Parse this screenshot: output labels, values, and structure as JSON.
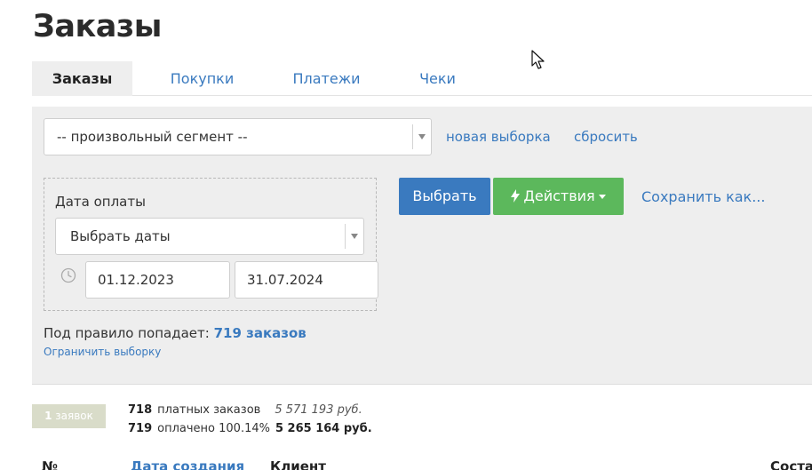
{
  "page": {
    "title": "Заказы"
  },
  "tabs": [
    {
      "label": "Заказы",
      "active": true
    },
    {
      "label": "Покупки",
      "active": false
    },
    {
      "label": "Платежи",
      "active": false
    },
    {
      "label": "Чеки",
      "active": false
    }
  ],
  "filter": {
    "segment_value": "-- произвольный сегмент --",
    "new_selection_link": "новая выборка",
    "reset_link": "сбросить",
    "date": {
      "label": "Дата оплаты",
      "select_value": "Выбрать даты",
      "from": "01.12.2023",
      "to": "31.07.2024"
    },
    "buttons": {
      "select": "Выбрать",
      "actions": "Действия",
      "save_as": "Сохранить как..."
    },
    "rule": {
      "prefix": "Под правило попадает:",
      "count": "719 заказов"
    },
    "limit_link": "Ограничить выборку"
  },
  "summary": {
    "badge_count": "1",
    "badge_label": "заявок",
    "paid_orders": {
      "count": "718",
      "label": "платных заказов",
      "sum": "5 571 193 руб."
    },
    "paid": {
      "count": "719",
      "label": "оплачено 100.14%",
      "sum": "5 265 164 руб."
    }
  },
  "table": {
    "columns": [
      "№",
      "Дата создания",
      "Клиент",
      "Соста"
    ]
  },
  "colors": {
    "link": "#3a7abf",
    "primary": "#3a7abf",
    "success": "#5cb85c",
    "panel_bg": "#eeeeee",
    "badge_bg": "#d9dcc9"
  }
}
